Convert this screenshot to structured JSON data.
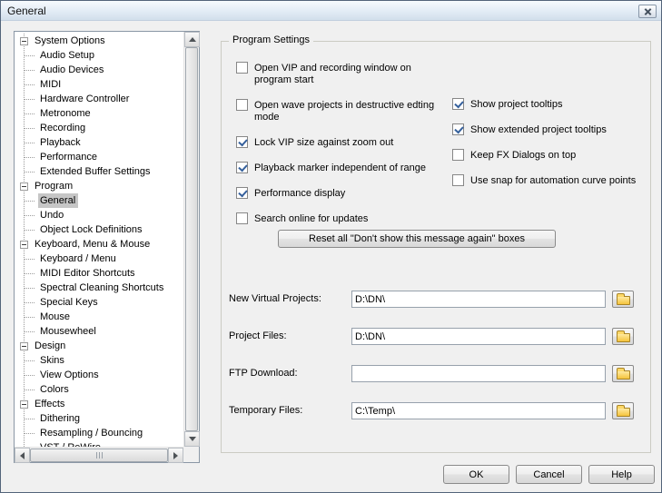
{
  "window": {
    "title": "General"
  },
  "colors": {
    "dialog_bg": "#F0F0F0",
    "titlebar_top": "#F7FAFD",
    "titlebar_bottom": "#D2DFEC",
    "tree_selection_bg": "#C6C6C6",
    "checkbox_check": "#35609C",
    "folder_yellow": "#F5C43C"
  },
  "icons": {
    "close-icon": "x-cross",
    "collapse-icon": "minus-box",
    "folder-icon": "yellow-folder",
    "arrow-up-icon": "triangle-up",
    "arrow-down-icon": "triangle-down",
    "arrow-left-icon": "triangle-left",
    "arrow-right-icon": "triangle-right",
    "scroll-grip-icon": "vertical-lines"
  },
  "tree": {
    "items": [
      {
        "label": "System Options",
        "level": 0,
        "expanded": true
      },
      {
        "label": "Audio Setup",
        "level": 1
      },
      {
        "label": "Audio Devices",
        "level": 1
      },
      {
        "label": "MIDI",
        "level": 1
      },
      {
        "label": "Hardware Controller",
        "level": 1
      },
      {
        "label": "Metronome",
        "level": 1
      },
      {
        "label": "Recording",
        "level": 1
      },
      {
        "label": "Playback",
        "level": 1
      },
      {
        "label": "Performance",
        "level": 1
      },
      {
        "label": "Extended Buffer Settings",
        "level": 1
      },
      {
        "label": "Program",
        "level": 0,
        "expanded": true
      },
      {
        "label": "General",
        "level": 1,
        "selected": true
      },
      {
        "label": "Undo",
        "level": 1
      },
      {
        "label": "Object Lock Definitions",
        "level": 1
      },
      {
        "label": "Keyboard, Menu & Mouse",
        "level": 0,
        "expanded": true
      },
      {
        "label": "Keyboard / Menu",
        "level": 1
      },
      {
        "label": "MIDI Editor Shortcuts",
        "level": 1
      },
      {
        "label": "Spectral Cleaning Shortcuts",
        "level": 1
      },
      {
        "label": "Special Keys",
        "level": 1
      },
      {
        "label": "Mouse",
        "level": 1
      },
      {
        "label": "Mousewheel",
        "level": 1
      },
      {
        "label": "Design",
        "level": 0,
        "expanded": true
      },
      {
        "label": "Skins",
        "level": 1
      },
      {
        "label": "View Options",
        "level": 1
      },
      {
        "label": "Colors",
        "level": 1
      },
      {
        "label": "Effects",
        "level": 0,
        "expanded": true
      },
      {
        "label": "Dithering",
        "level": 1
      },
      {
        "label": "Resampling / Bouncing",
        "level": 1
      },
      {
        "label": "VST / ReWire",
        "level": 1,
        "clipped": true
      }
    ]
  },
  "program_settings": {
    "group_label": "Program Settings",
    "checkboxes_left": [
      {
        "label": "Open VIP and recording window on\nprogram start",
        "checked": false
      },
      {
        "label": "Open wave projects in destructive edting\nmode",
        "checked": false
      },
      {
        "label": "Lock VIP size against zoom out",
        "checked": true
      },
      {
        "label": "Playback marker independent of range",
        "checked": true
      },
      {
        "label": "Performance display",
        "checked": true
      },
      {
        "label": "Search online for updates",
        "checked": false
      }
    ],
    "checkboxes_right": [
      {
        "label": "Show project tooltips",
        "checked": true
      },
      {
        "label": "Show extended project tooltips",
        "checked": true
      },
      {
        "label": "Keep FX Dialogs on top",
        "checked": false
      },
      {
        "label": "Use snap for automation curve points",
        "checked": false
      }
    ],
    "reset_button_label": "Reset all \"Don't show this message again\" boxes",
    "paths": [
      {
        "label": "New Virtual Projects:",
        "value": "D:\\DN\\"
      },
      {
        "label": "Project Files:",
        "value": "D:\\DN\\"
      },
      {
        "label": "FTP Download:",
        "value": ""
      },
      {
        "label": "Temporary Files:",
        "value": "C:\\Temp\\"
      }
    ]
  },
  "footer": {
    "ok": "OK",
    "cancel": "Cancel",
    "help": "Help"
  }
}
